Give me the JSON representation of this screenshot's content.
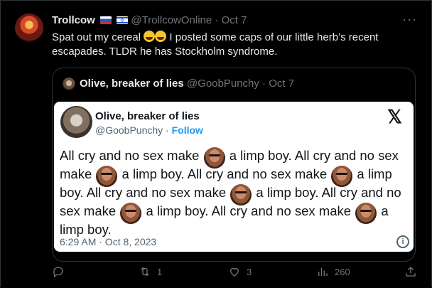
{
  "post": {
    "display_name": "Trollcow",
    "handle": "@TrollcowOnline",
    "separator": "·",
    "date": "Oct 7",
    "text": "Spat out my cereal 🤣😁 I posted some caps of our little herb's recent escapades. TLDR he has Stockholm syndrome.",
    "text_before_emoji": "Spat out my cereal",
    "text_after_emoji": "I posted some caps of our little herb’s recent escapades. TLDR he has Stockholm syndrome.",
    "flags": [
      "flag-russia",
      "flag-israel"
    ],
    "more_label": "···"
  },
  "quote": {
    "display_name": "Olive, breaker of lies",
    "handle": "@GoobPunchy",
    "separator": "·",
    "date": "Oct 7"
  },
  "card": {
    "display_name": "Olive, breaker of lies",
    "handle": "@GoobPunchy",
    "separator": "·",
    "follow_label": "Follow",
    "logo": "x-logo",
    "segments": [
      "All cry and no sex make",
      "a limp boy. All cry and no sex make",
      "a limp boy. All cry and no sex make",
      "a limp boy. All cry and no sex make",
      "a limp boy. All cry and no sex make",
      "a limp boy. All cry and no sex make",
      "a limp boy."
    ],
    "timestamp": "6:29 AM · Oct 8, 2023",
    "info_icon": "i"
  },
  "actions": {
    "reply_count": "",
    "retweet_count": "1",
    "like_count": "3",
    "views_count": "260"
  }
}
